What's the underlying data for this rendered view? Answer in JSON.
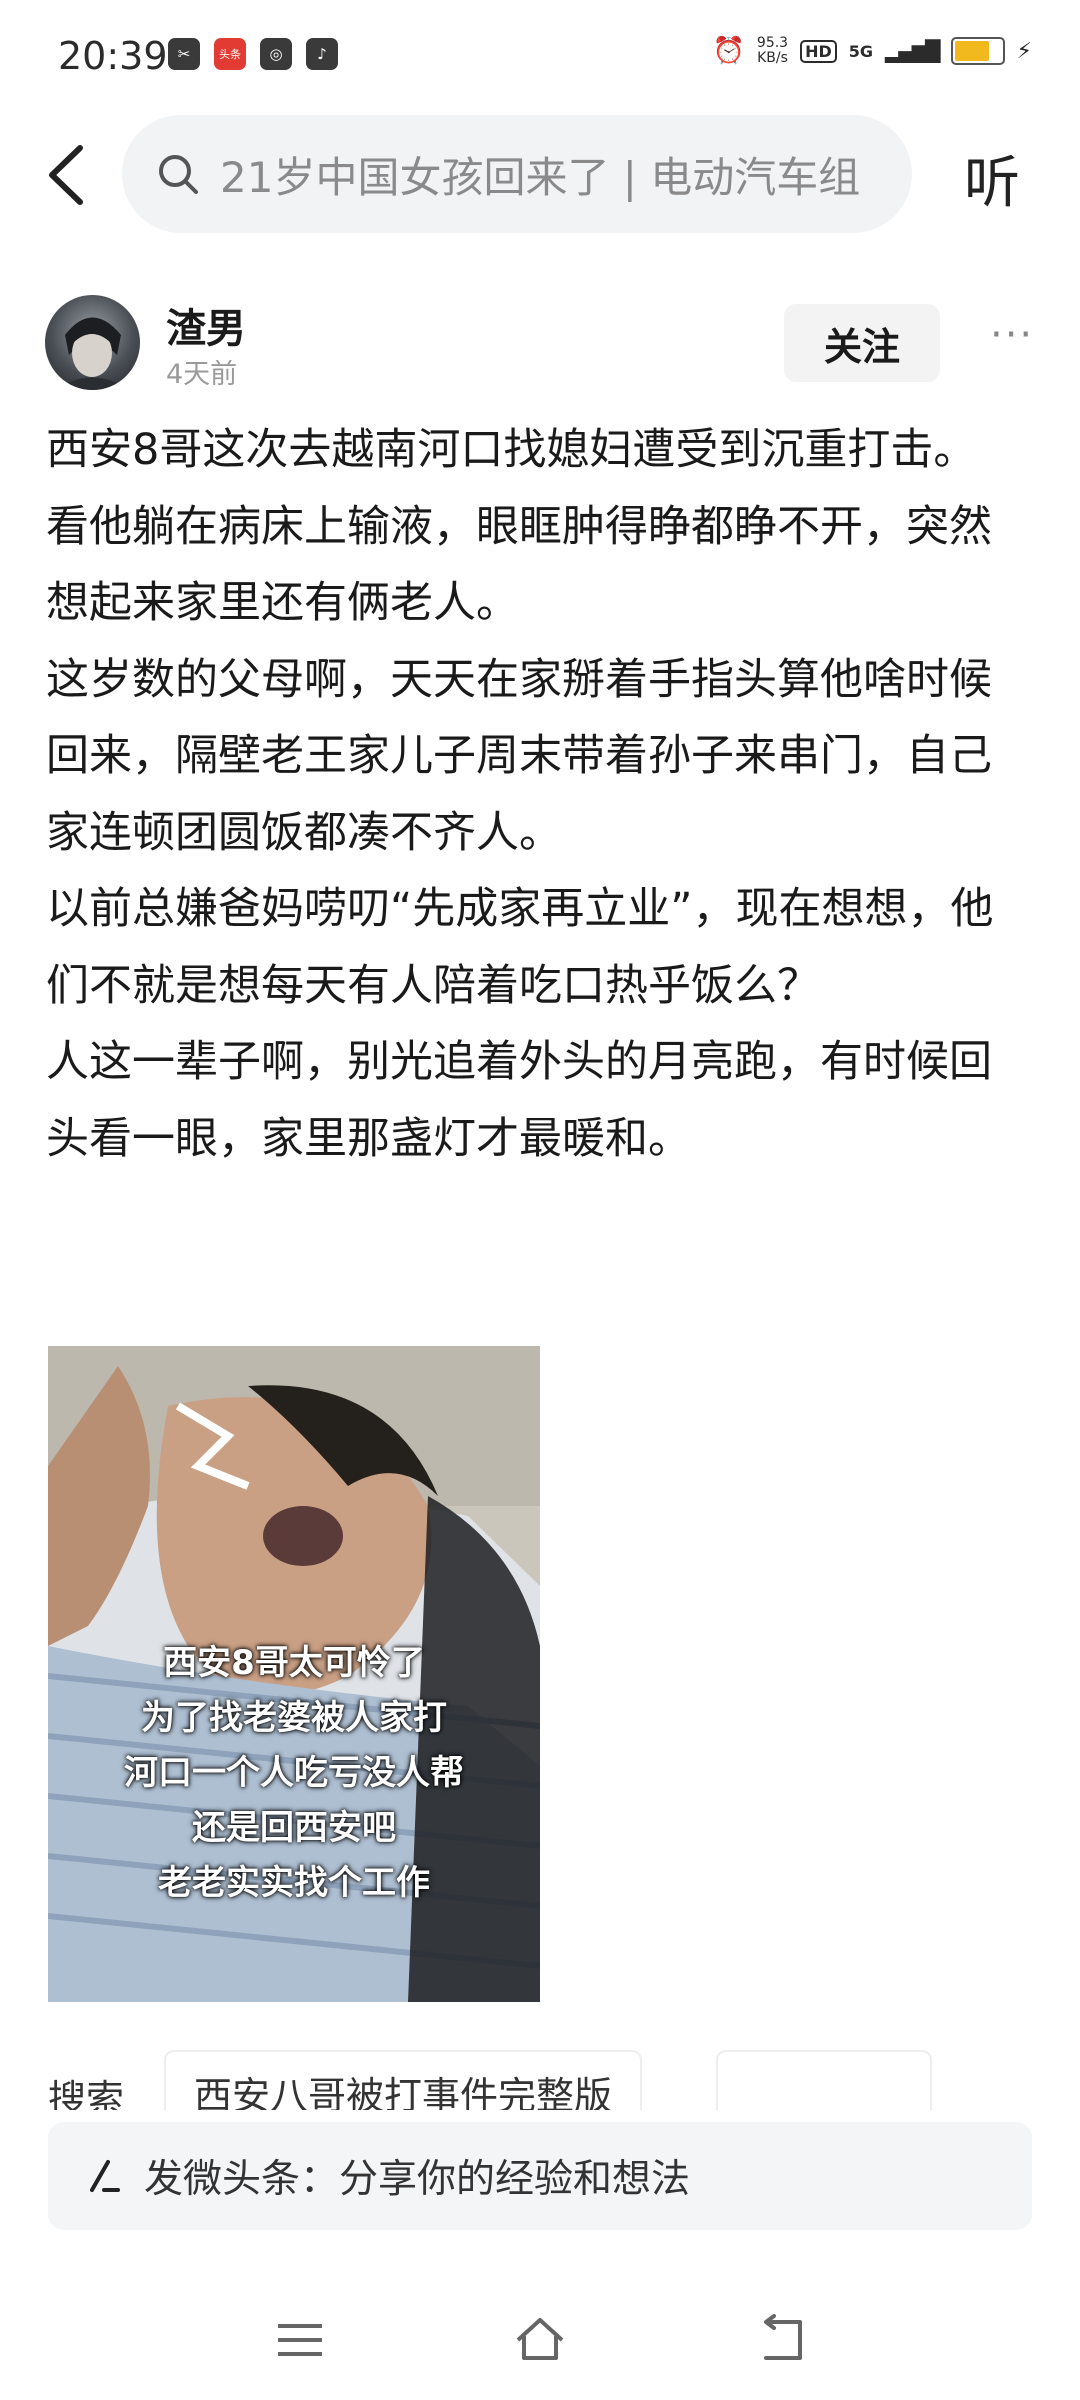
{
  "status_bar": {
    "time": "20:39",
    "app_badge": "头条",
    "speed_value": "95.3",
    "speed_unit": "KB/s",
    "hd": "HD",
    "network": "5G"
  },
  "search": {
    "placeholder": "21岁中国女孩回来了 | 电动汽车组"
  },
  "listen_label": "听",
  "author": {
    "name": "渣男",
    "time": "4天前",
    "follow_label": "关注",
    "more_label": "···"
  },
  "post": {
    "paragraphs": [
      "西安8哥这次去越南河口找媳妇遭受到沉重打击。",
      "看他躺在病床上输液，眼眶肿得睁都睁不开，突然想起来家里还有俩老人。",
      "这岁数的父母啊，天天在家掰着手指头算他啥时候回来，隔壁老王家儿子周末带着孙子来串门，自己家连顿团圆饭都凑不齐人。",
      "以前总嫌爸妈唠叨“先成家再立业”，现在想想，他们不就是想每天有人陪着吃口热乎饭么？",
      "人这一辈子啊，别光追着外头的月亮跑，有时候回头看一眼，家里那盏灯才最暖和。"
    ]
  },
  "image_caption": [
    "西安8哥太可怜了",
    "为了找老婆被人家打",
    "河口一个人吃亏没人帮",
    "还是回西安吧",
    "老老实实找个工作"
  ],
  "search_suggest": {
    "label": "搜索",
    "chip": "西安八哥被打事件完整版"
  },
  "compose": {
    "placeholder": "发微头条：分享你的经验和想法"
  },
  "colors": {
    "battery": "#f1b91e",
    "search_bg": "#f2f3f5",
    "compose_bg": "#f4f5f7"
  }
}
